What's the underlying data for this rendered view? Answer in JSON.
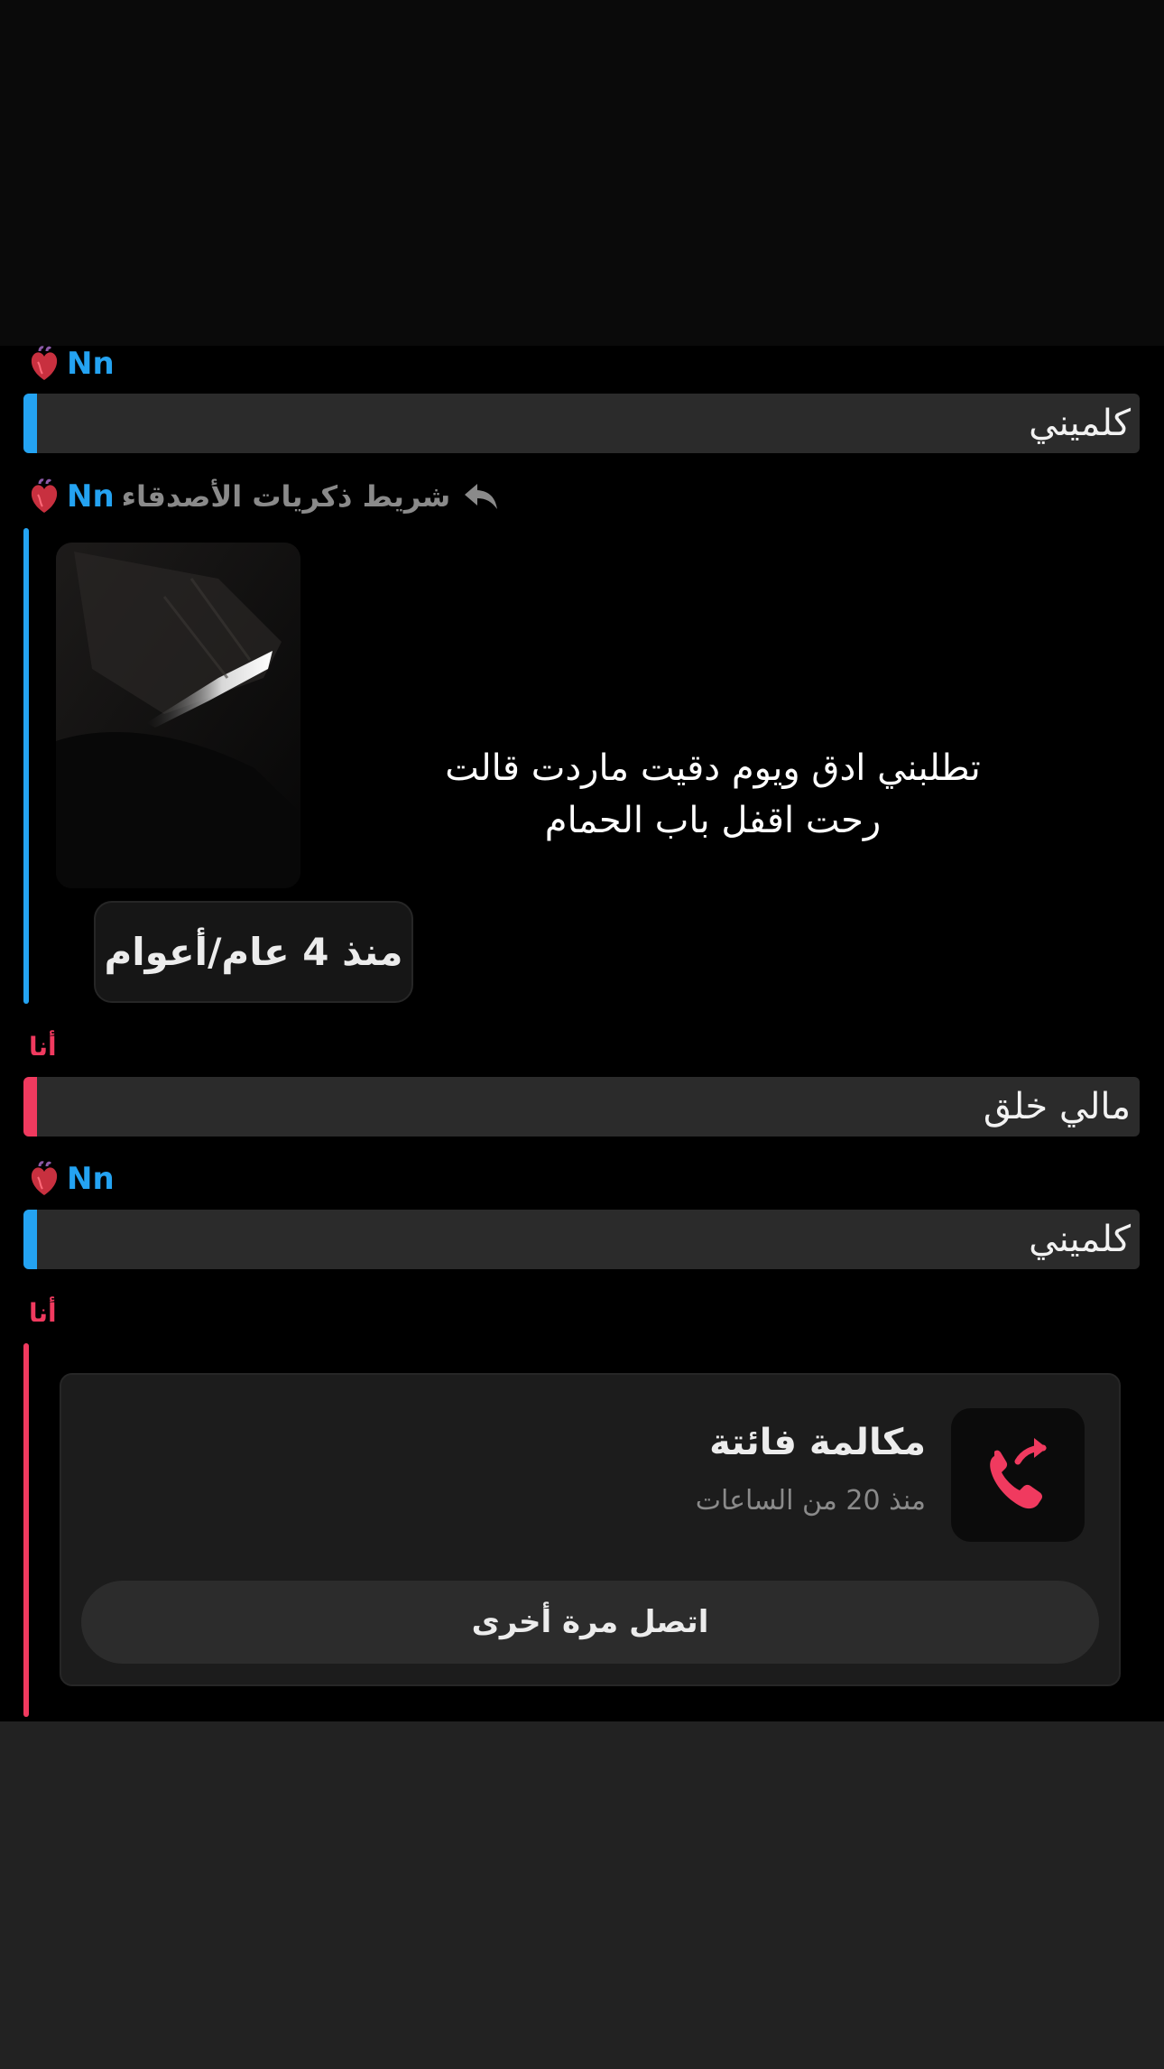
{
  "colors": {
    "friend_accent": "#24a3f2",
    "me_accent": "#f03a5f",
    "row_background": "#2b2b2b",
    "background": "#000000"
  },
  "icons": {
    "heart": "anatomical-heart-icon",
    "reply": "reply-arrow-icon",
    "missed_call": "outgoing-call-icon"
  },
  "messages": [
    {
      "sender": "Nn",
      "text": "كلميني"
    },
    {
      "sender": "Nn",
      "reply_label": "شريط ذكريات الأصدقاء",
      "memory_caption_line1": "تطلبني ادق ويوم دقيت ماردت قالت",
      "memory_caption_line2": "رحت اقفل باب الحمام",
      "memory_time": "منذ 4 عام/أعوام"
    },
    {
      "sender": "أنا",
      "text": "مالي خلق"
    },
    {
      "sender": "Nn",
      "text": "كلميني"
    },
    {
      "sender": "أنا",
      "call_title": "مكالمة فائتة",
      "call_time": "منذ 20 من الساعات",
      "call_again_label": "اتصل مرة أخرى"
    }
  ]
}
